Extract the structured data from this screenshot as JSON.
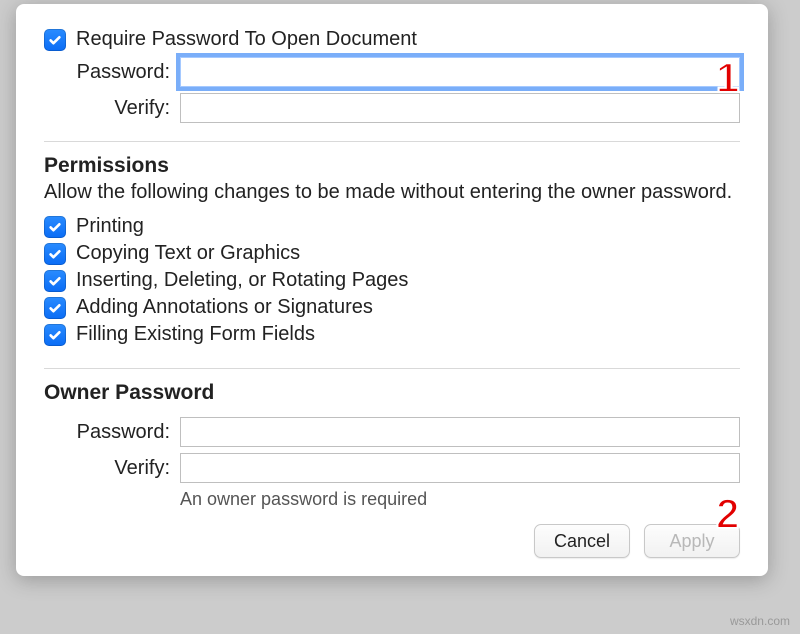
{
  "open_password_section": {
    "require_label": "Require Password To Open Document",
    "password_label": "Password:",
    "verify_label": "Verify:"
  },
  "permissions_section": {
    "title": "Permissions",
    "description": "Allow the following changes to be made without entering the owner password.",
    "items": [
      {
        "label": "Printing"
      },
      {
        "label": "Copying Text or Graphics"
      },
      {
        "label": "Inserting, Deleting, or Rotating Pages"
      },
      {
        "label": "Adding Annotations or Signatures"
      },
      {
        "label": "Filling Existing Form Fields"
      }
    ]
  },
  "owner_password_section": {
    "title": "Owner Password",
    "password_label": "Password:",
    "verify_label": "Verify:",
    "hint": "An owner password is required"
  },
  "buttons": {
    "cancel": "Cancel",
    "apply": "Apply"
  },
  "callouts": {
    "one": "1",
    "two": "2"
  },
  "watermark": "wsxdn.com"
}
